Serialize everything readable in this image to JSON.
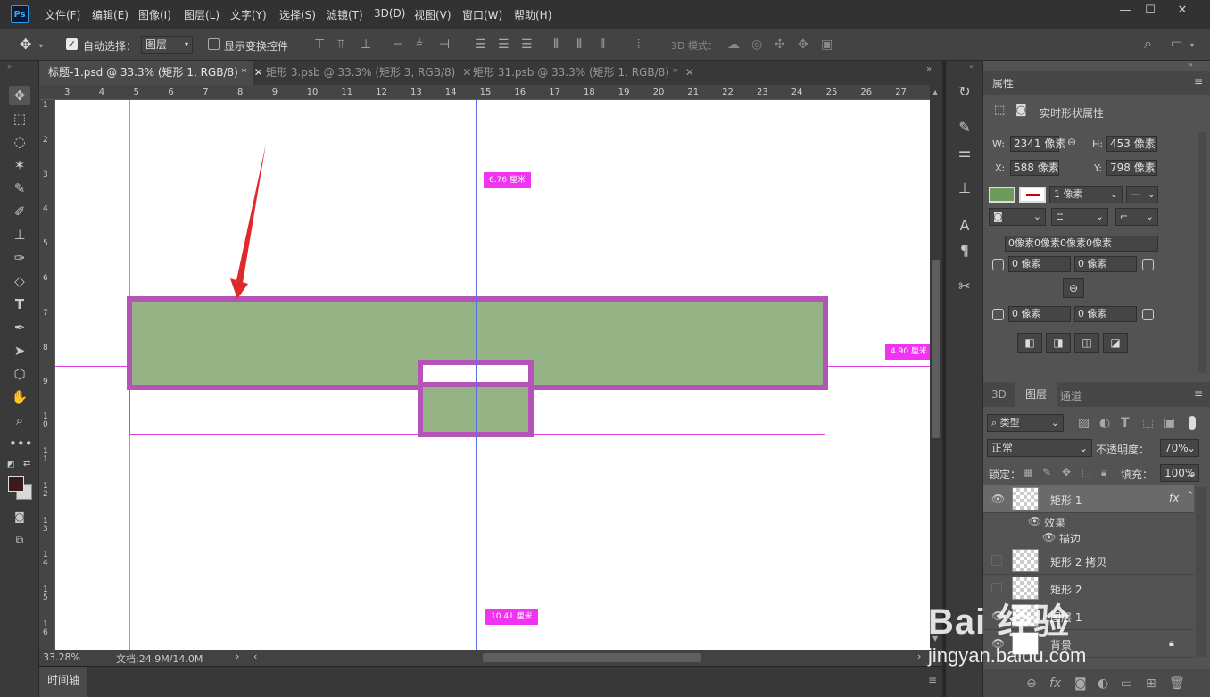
{
  "app": {
    "logo": "Ps"
  },
  "menu": [
    "文件(F)",
    "编辑(E)",
    "图像(I)",
    "图层(L)",
    "文字(Y)",
    "选择(S)",
    "滤镜(T)",
    "3D(D)",
    "视图(V)",
    "窗口(W)",
    "帮助(H)"
  ],
  "window_controls": {
    "minimize": "—",
    "restore": "☐",
    "close": "✕"
  },
  "options": {
    "auto_select_label": "自动选择：",
    "auto_select_checked": true,
    "auto_select_target": "图层",
    "transform_label": "显示变换控件",
    "mode_3d_label": "3D 模式："
  },
  "tabs": [
    {
      "label": "标题-1.psd @ 33.3% (矩形 1, RGB/8) *",
      "active": true
    },
    {
      "label": "矩形 3.psb @ 33.3% (矩形 3, RGB/8)",
      "active": false
    },
    {
      "label": "矩形 31.psb @ 33.3% (矩形 1, RGB/8) *",
      "active": false
    }
  ],
  "ruler_top": [
    "3",
    "4",
    "5",
    "6",
    "7",
    "8",
    "9",
    "10",
    "11",
    "12",
    "13",
    "14",
    "15",
    "16",
    "17",
    "18",
    "19",
    "20",
    "21",
    "22",
    "23",
    "24",
    "25",
    "26",
    "27"
  ],
  "ruler_left": [
    "1",
    "2",
    "3",
    "4",
    "5",
    "6",
    "7",
    "8",
    "9",
    "1\n0",
    "1\n1",
    "1\n2",
    "1\n3",
    "1\n4",
    "1\n5",
    "1\n6"
  ],
  "canvas": {
    "measure_top": "6.76 厘米",
    "measure_right": "4.90 厘米",
    "measure_bottom": "10.41 厘米",
    "shape_fill": "#95b485",
    "stroke_color": "#b553b8"
  },
  "status": {
    "zoom": "33.28%",
    "doc": "文档:24.9M/14.0M"
  },
  "timeline": {
    "label": "时间轴"
  },
  "properties": {
    "title": "属性",
    "subtitle": "实时形状属性",
    "w_label": "W:",
    "w_value": "2341 像素",
    "h_label": "H:",
    "h_value": "453 像素",
    "x_label": "X:",
    "x_value": "588 像素",
    "y_label": "Y:",
    "y_value": "798 像素",
    "fill_color": "#6e9a5c",
    "stroke_width": "1 像素",
    "corners_all": "0像素0像素0像素0像素",
    "corner_tl": "0 像素",
    "corner_tr": "0 像素",
    "corner_bl": "0 像素",
    "corner_br": "0 像素"
  },
  "layers_panel": {
    "tabs": [
      "3D",
      "图层",
      "通道"
    ],
    "filter": "类型",
    "blend_mode": "正常",
    "opacity_label": "不透明度：",
    "opacity": "70%",
    "lock_label": "锁定：",
    "fill_label": "填充：",
    "fill": "100%",
    "layers": [
      {
        "name": "矩形 1",
        "visible": true,
        "fx": "fx",
        "selected": true
      },
      {
        "name": "效果",
        "sub": true
      },
      {
        "name": "描边",
        "sub2": true
      },
      {
        "name": "矩形 2 拷贝",
        "visible": false
      },
      {
        "name": "矩形 2",
        "visible": false
      },
      {
        "name": "图层 1",
        "visible": true
      },
      {
        "name": "背景",
        "visible": true,
        "locked": true
      }
    ]
  },
  "watermark": {
    "text": "Bai 经验",
    "url_text": "jingyan.baidu.com"
  }
}
